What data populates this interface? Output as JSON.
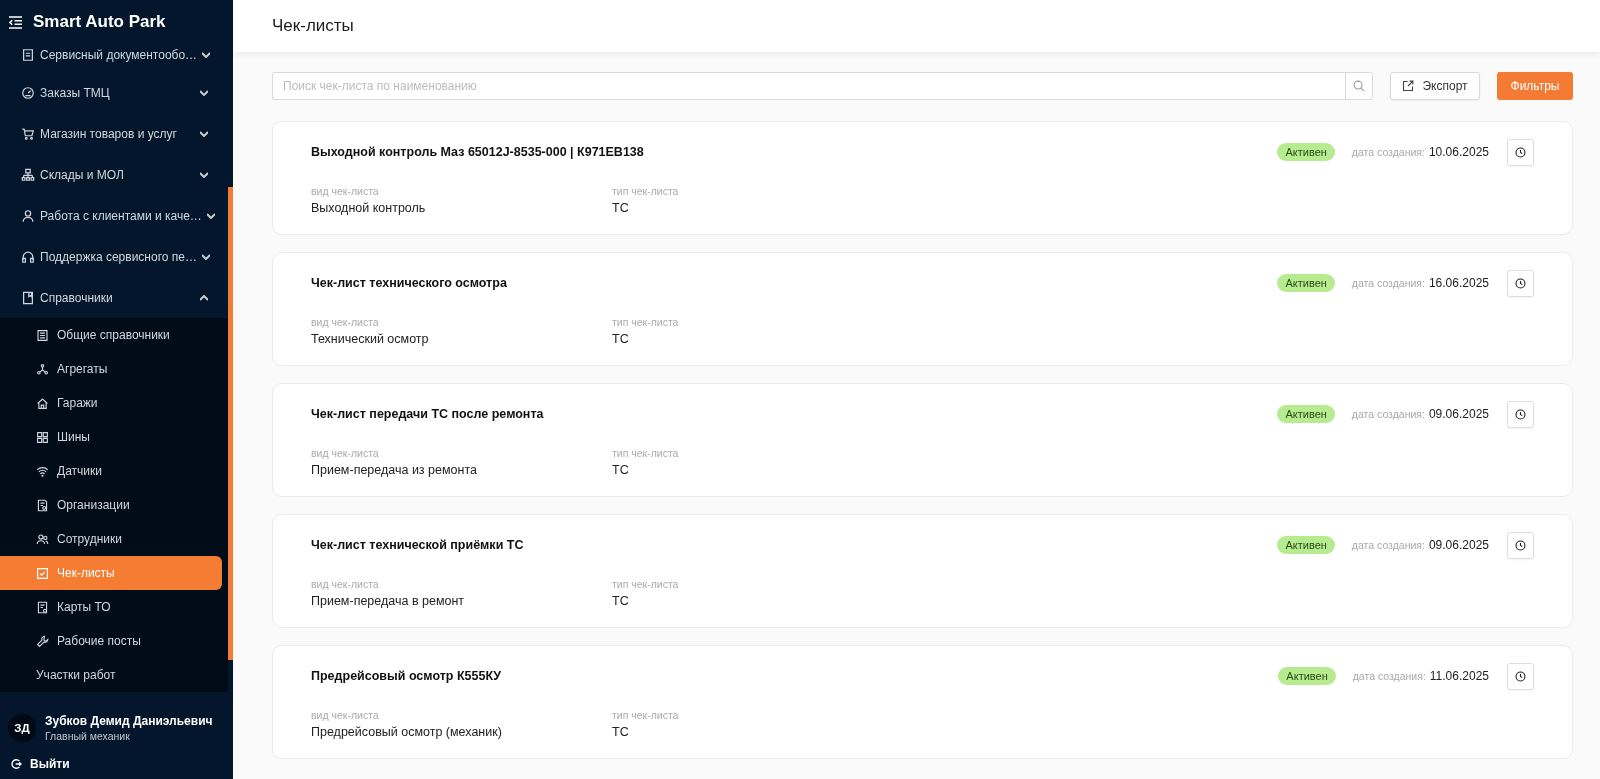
{
  "sidebar": {
    "logo": "Smart Auto Park",
    "items": [
      {
        "label": "Сервисный документообо…",
        "expanded": false
      },
      {
        "label": "Заказы ТМЦ",
        "expanded": false
      },
      {
        "label": "Магазин товаров и услуг",
        "expanded": false
      },
      {
        "label": "Склады и МОЛ",
        "expanded": false
      },
      {
        "label": "Работа с клиентами и каче…",
        "expanded": false
      },
      {
        "label": "Поддержка сервисного пе…",
        "expanded": false
      },
      {
        "label": "Справочники",
        "expanded": true,
        "children": [
          {
            "label": "Общие справочники",
            "selected": false
          },
          {
            "label": "Агрегаты",
            "selected": false
          },
          {
            "label": "Гаражи",
            "selected": false
          },
          {
            "label": "Шины",
            "selected": false
          },
          {
            "label": "Датчики",
            "selected": false
          },
          {
            "label": "Организации",
            "selected": false
          },
          {
            "label": "Сотрудники",
            "selected": false
          },
          {
            "label": "Чек-листы",
            "selected": true
          },
          {
            "label": "Карты ТО",
            "selected": false
          },
          {
            "label": "Рабочие посты",
            "selected": false
          },
          {
            "label": "Участки работ",
            "selected": false
          }
        ]
      }
    ]
  },
  "user": {
    "initials": "ЗД",
    "name": "Зубков Демид Даниэльевич",
    "role": "Главный механик"
  },
  "logout": {
    "label": "Выйти"
  },
  "header": {
    "title": "Чек-листы"
  },
  "toolbar": {
    "search": {
      "placeholder": "Поиск чек-листа по наименованию"
    },
    "buttons": [
      {
        "kind": "export",
        "label": "Экспорт"
      },
      {
        "kind": "primary",
        "label": "Фильтры"
      }
    ]
  },
  "checklists": [
    {
      "title": "Выходной контроль Маз 65012J-8535-000 | К971ЕВ138",
      "status": "Активен",
      "date_label": "дата создания:",
      "date": "10.06.2025",
      "fields": [
        {
          "label": "вид чек-листа",
          "value": "Выходной контроль"
        },
        {
          "label": "тип чек-листа",
          "value": "ТС"
        }
      ]
    },
    {
      "title": "Чек-лист технического осмотра",
      "status": "Активен",
      "date_label": "дата создания:",
      "date": "16.06.2025",
      "fields": [
        {
          "label": "вид чек-листа",
          "value": "Технический осмотр"
        },
        {
          "label": "тип чек-листа",
          "value": "ТС"
        }
      ]
    },
    {
      "title": "Чек-лист передачи ТС после ремонта",
      "status": "Активен",
      "date_label": "дата создания:",
      "date": "09.06.2025",
      "fields": [
        {
          "label": "вид чек-листа",
          "value": "Прием-передача из ремонта"
        },
        {
          "label": "тип чек-листа",
          "value": "ТС"
        }
      ]
    },
    {
      "title": "Чек-лист технической приёмки ТС",
      "status": "Активен",
      "date_label": "дата создания:",
      "date": "09.06.2025",
      "fields": [
        {
          "label": "вид чек-листа",
          "value": "Прием-передача в ремонт"
        },
        {
          "label": "тип чек-листа",
          "value": "ТС"
        }
      ]
    },
    {
      "title": "Предрейсовый осмотр К555КУ",
      "status": "Активен",
      "date_label": "дата создания:",
      "date": "11.06.2025",
      "fields": [
        {
          "label": "вид чек-листа",
          "value": "Предрейсовый осмотр (механик)"
        },
        {
          "label": "тип чек-листа",
          "value": "ТС"
        }
      ]
    }
  ]
}
